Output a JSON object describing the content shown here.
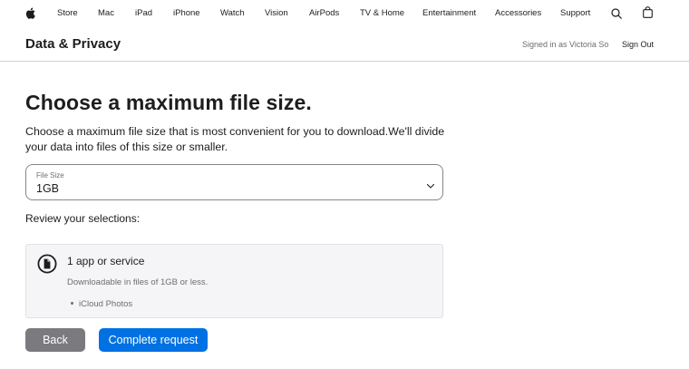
{
  "global_nav": {
    "items": [
      "Store",
      "Mac",
      "iPad",
      "iPhone",
      "Watch",
      "Vision",
      "AirPods",
      "TV & Home",
      "Entertainment",
      "Accessories",
      "Support"
    ],
    "logo_icon": "apple-logo-icon",
    "search_icon": "search-icon",
    "bag_icon": "bag-icon"
  },
  "sub_nav": {
    "title": "Data & Privacy",
    "signed_in": "Signed in as Victoria So",
    "sign_out": "Sign Out"
  },
  "main": {
    "heading": "Choose a maximum file size.",
    "description": "Choose a maximum file size that is most convenient for you to download.We'll divide your data into files of this size or smaller.",
    "file_size": {
      "label": "File Size",
      "value": "1GB"
    },
    "review_label": "Review your selections:",
    "selection": {
      "title": "1 app or service",
      "subtitle": "Downloadable in files of 1GB or less.",
      "items": [
        "iCloud Photos"
      ]
    },
    "buttons": {
      "back": "Back",
      "complete": "Complete request"
    }
  },
  "colors": {
    "primary_blue": "#0071e3",
    "back_gray": "#7b7b7f",
    "card_bg": "#f5f5f7"
  }
}
